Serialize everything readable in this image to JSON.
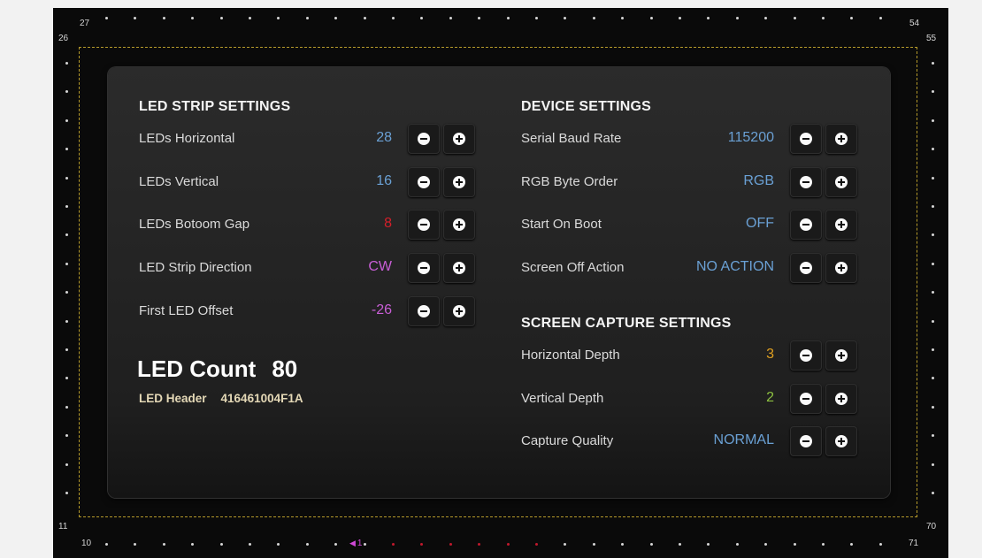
{
  "corners": {
    "top_left_outer": "26",
    "top_left_inner": "27",
    "top_right_outer": "55",
    "top_right_inner": "54",
    "bottom_left_outer": "11",
    "bottom_left_inner": "10",
    "bottom_right_outer": "70",
    "bottom_right_inner": "71"
  },
  "position_marker": {
    "arrow_icon": "triangle-left-icon",
    "number": "1"
  },
  "led_strip": {
    "title": "LED STRIP SETTINGS",
    "rows": [
      {
        "label": "LEDs Horizontal",
        "value": "28",
        "color": "#6aa0d4"
      },
      {
        "label": "LEDs Vertical",
        "value": "16",
        "color": "#6aa0d4"
      },
      {
        "label": "LEDs Botoom Gap",
        "value": "8",
        "color": "#d61f2a"
      },
      {
        "label": "LED Strip Direction",
        "value": "CW",
        "color": "#c85ed6"
      },
      {
        "label": "First LED Offset",
        "value": "-26",
        "color": "#c85ed6"
      }
    ],
    "count_label": "LED Count",
    "count_value": "80",
    "header_label": "LED Header",
    "header_value": "416461004F1A"
  },
  "device": {
    "title": "DEVICE SETTINGS",
    "rows": [
      {
        "label": "Serial Baud Rate",
        "value": "115200",
        "color": "#6aa0d4"
      },
      {
        "label": "RGB Byte Order",
        "value": "RGB",
        "color": "#6aa0d4"
      },
      {
        "label": "Start On Boot",
        "value": "OFF",
        "color": "#6aa0d4"
      },
      {
        "label": "Screen Off Action",
        "value": "NO ACTION",
        "color": "#6aa0d4"
      }
    ]
  },
  "capture": {
    "title": "SCREEN CAPTURE SETTINGS",
    "rows": [
      {
        "label": "Horizontal Depth",
        "value": "3",
        "color": "#e0a020"
      },
      {
        "label": "Vertical Depth",
        "value": "2",
        "color": "#8cc040"
      },
      {
        "label": "Capture Quality",
        "value": "NORMAL",
        "color": "#6aa0d4"
      }
    ]
  },
  "icons": {
    "decrement": "minus-circle-icon",
    "increment": "plus-circle-icon"
  }
}
